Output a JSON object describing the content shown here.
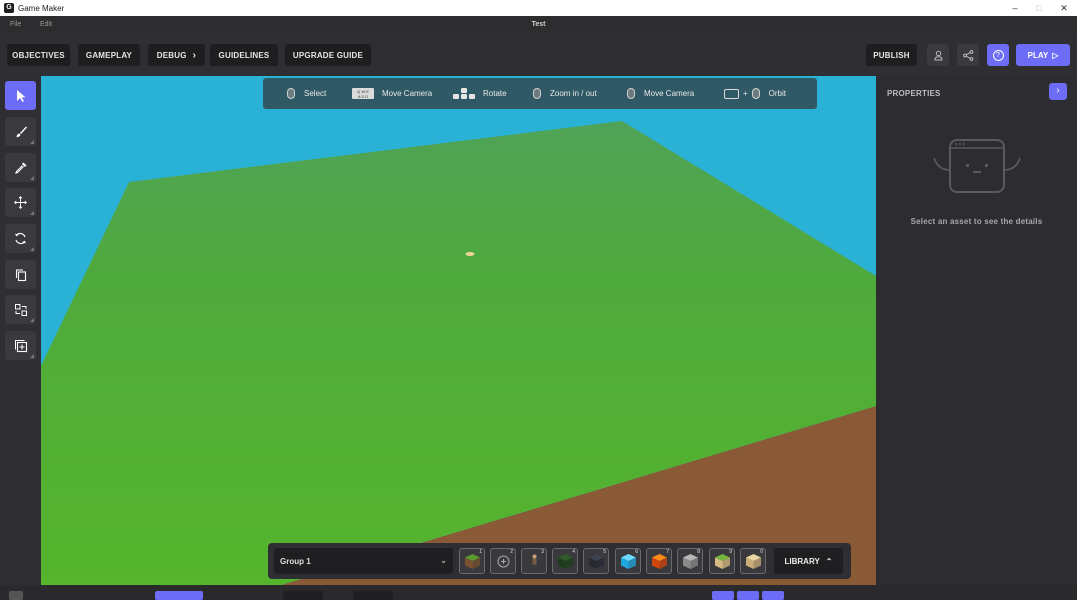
{
  "window": {
    "app_title": "Game Maker",
    "app_icon": "game-maker-logo-icon",
    "controls": [
      "–",
      "□",
      "✕"
    ]
  },
  "menu": {
    "items": [
      "File",
      "Edit"
    ],
    "document_title": "Test"
  },
  "toolbar": {
    "objectives": "OBJECTIVES",
    "gameplay": "GAMEPLAY",
    "debug": "DEBUG",
    "debug_chevron": "›",
    "guidelines": "GUIDELINES",
    "upgrade_guide": "UPGRADE GUIDE",
    "publish": "PUBLISH",
    "play": "PLAY",
    "play_icon": "▷"
  },
  "tools": [
    {
      "name": "select-tool",
      "icon": "cursor-arrow-icon",
      "active": true
    },
    {
      "name": "paint-tool",
      "icon": "brush-icon"
    },
    {
      "name": "eyedropper-tool",
      "icon": "eyedropper-icon"
    },
    {
      "name": "move-tool",
      "icon": "move-arrows-icon"
    },
    {
      "name": "rotate-tool",
      "icon": "rotate-icon"
    },
    {
      "name": "duplicate-tool",
      "icon": "copy-icon"
    },
    {
      "name": "swap-tool",
      "icon": "swap-icon"
    },
    {
      "name": "add-tool",
      "icon": "add-box-icon"
    }
  ],
  "hints": {
    "select": "Select",
    "keys_top": "Q W E",
    "keys_bottom": "A S D",
    "move_camera": "Move Camera",
    "rotate": "Rotate",
    "zoom": "Zoom in / out",
    "move_camera_2": "Move Camera",
    "plus": "+",
    "orbit": "Orbit"
  },
  "properties": {
    "title": "PROPERTIES",
    "collapse_icon": "›",
    "empty_message": "Select an asset to see the details"
  },
  "hotbar": {
    "group": "Group 1",
    "group_chevron": "⌄",
    "slots": [
      {
        "num": "1",
        "icon": "grass-block-icon",
        "top": "#5a9b2f",
        "side": "#7a5230"
      },
      {
        "num": "2",
        "icon": "empty-slot-plus-icon"
      },
      {
        "num": "3",
        "icon": "character-figure-icon"
      },
      {
        "num": "4",
        "icon": "leaf-patch-icon",
        "top": "#2f5a2a",
        "side": "#1f3d1c"
      },
      {
        "num": "5",
        "icon": "dark-ore-icon",
        "top": "#3c4250",
        "side": "#262a33"
      },
      {
        "num": "6",
        "icon": "ice-block-icon",
        "top": "#6fdcff",
        "side": "#1fa7e0"
      },
      {
        "num": "7",
        "icon": "lava-block-icon",
        "top": "#ff8a1c",
        "side": "#d0460b"
      },
      {
        "num": "8",
        "icon": "stone-block-icon",
        "top": "#b8b8b8",
        "side": "#8a8a8a"
      },
      {
        "num": "9",
        "icon": "grass-sand-block-icon",
        "top": "#76b53e",
        "side": "#d6b981"
      },
      {
        "num": "0",
        "icon": "sand-block-icon",
        "top": "#ead6a4",
        "side": "#c9ae78"
      }
    ],
    "library": "LIBRARY",
    "library_chevron": "⌃"
  },
  "colors": {
    "accent": "#6d6cf6",
    "sky": "#2ab2d6",
    "grass": "#56b02f",
    "dirt": "#8a5a36"
  }
}
